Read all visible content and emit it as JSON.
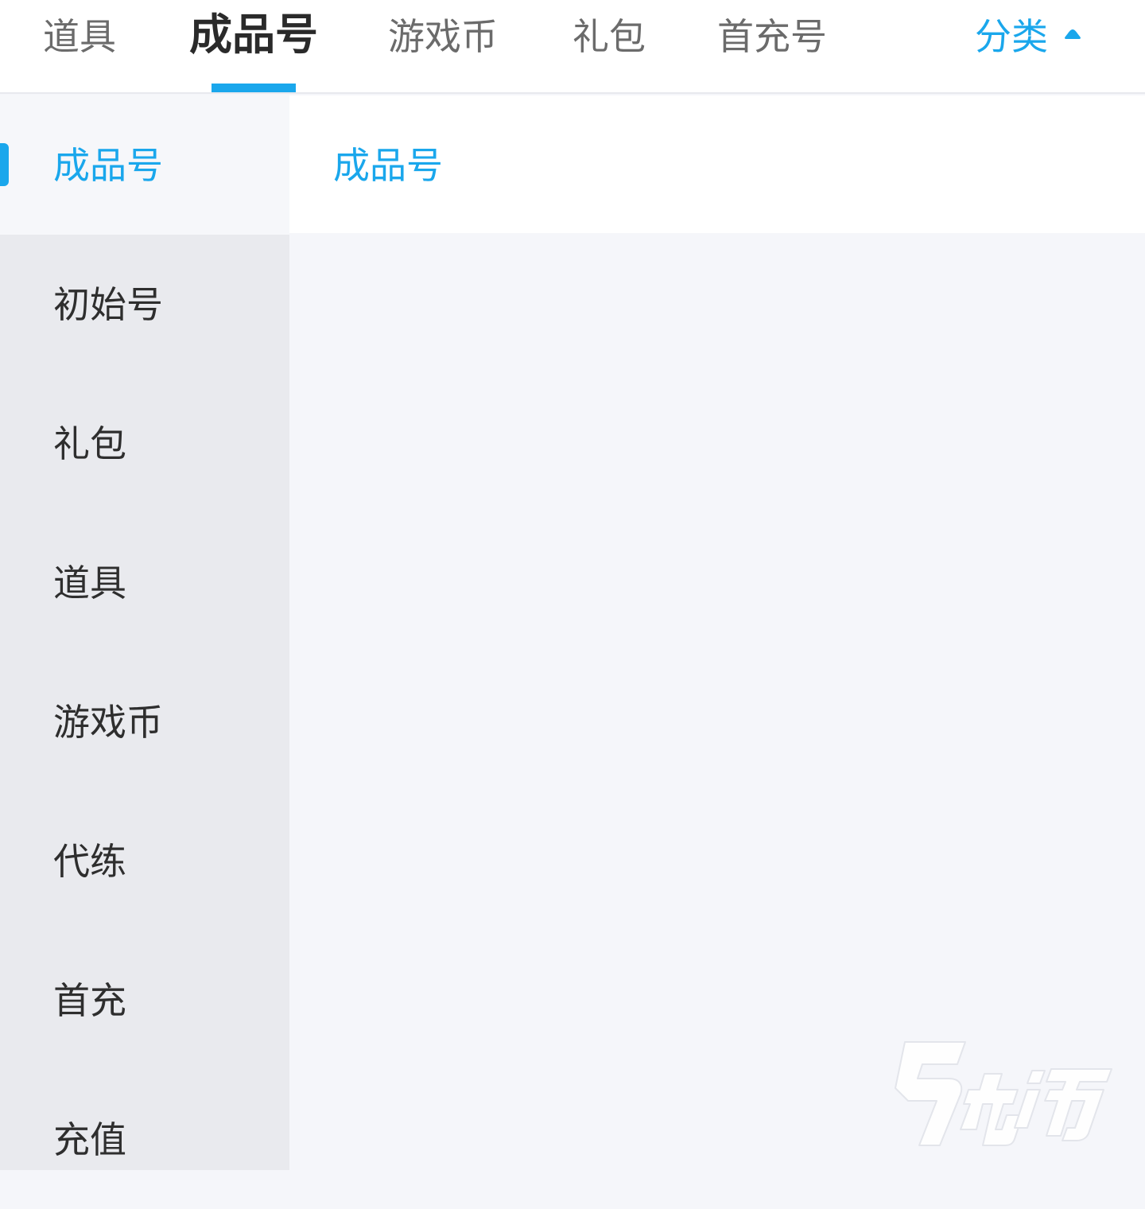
{
  "tabs": [
    {
      "label": "道具",
      "active": false
    },
    {
      "label": "成品号",
      "active": true
    },
    {
      "label": "游戏币",
      "active": false
    },
    {
      "label": "礼包",
      "active": false
    },
    {
      "label": "首充号",
      "active": false
    }
  ],
  "category_toggle": {
    "label": "分类",
    "icon": "caret-up-icon"
  },
  "sidebar": {
    "items": [
      {
        "label": "成品号",
        "active": true
      },
      {
        "label": "初始号",
        "active": false
      },
      {
        "label": "礼包",
        "active": false
      },
      {
        "label": "道具",
        "active": false
      },
      {
        "label": "游戏币",
        "active": false
      },
      {
        "label": "代练",
        "active": false
      },
      {
        "label": "首充",
        "active": false
      },
      {
        "label": "充值",
        "active": false
      }
    ]
  },
  "content": {
    "title": "成品号"
  },
  "watermark": {
    "text": "九游"
  },
  "colors": {
    "accent": "#1aa7ec",
    "sidebar_bg": "#e9eaee",
    "content_bg": "#f5f6fa"
  }
}
